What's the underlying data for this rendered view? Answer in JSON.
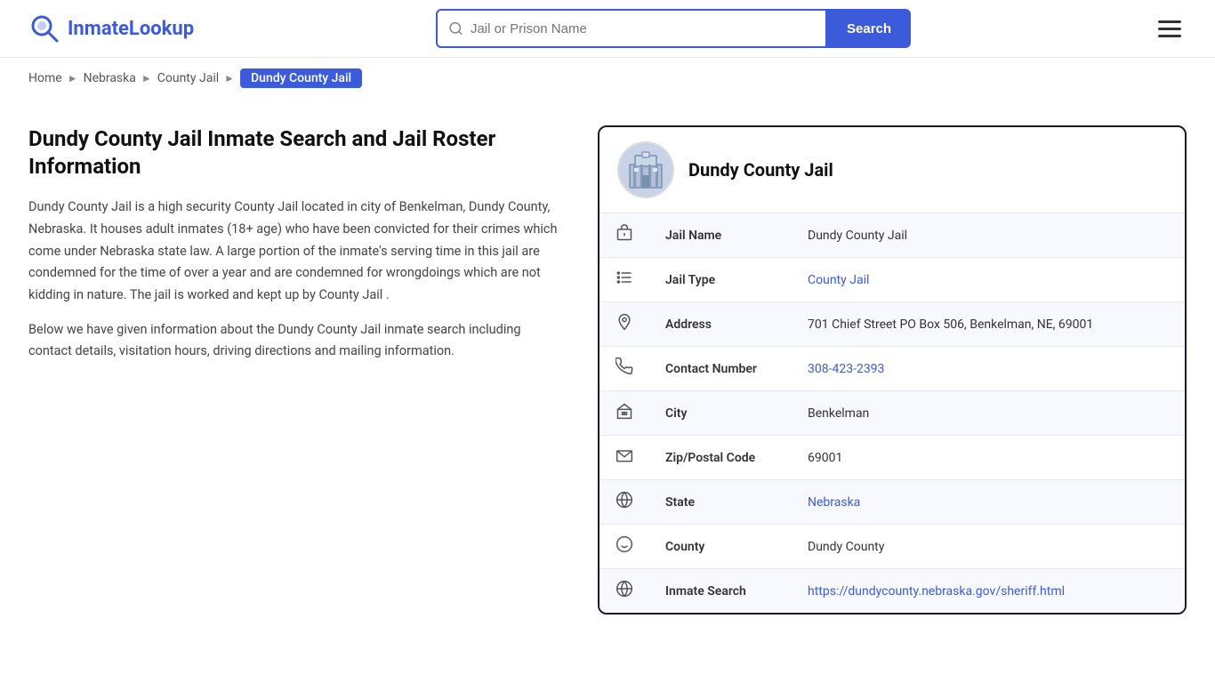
{
  "header": {
    "logo_brand": "InmateLookup",
    "logo_brand_first": "Inmate",
    "logo_brand_second": "Lookup",
    "search_placeholder": "Jail or Prison Name",
    "search_button_label": "Search"
  },
  "breadcrumb": {
    "items": [
      {
        "label": "Home",
        "href": "#"
      },
      {
        "label": "Nebraska",
        "href": "#"
      },
      {
        "label": "County Jail",
        "href": "#"
      },
      {
        "label": "Dundy County Jail",
        "current": true
      }
    ]
  },
  "left": {
    "page_title": "Dundy County Jail Inmate Search and Jail Roster Information",
    "description1": "Dundy County Jail is a high security County Jail located in city of Benkelman, Dundy County, Nebraska. It houses adult inmates (18+ age) who have been convicted for their crimes which come under Nebraska state law. A large portion of the inmate's serving time in this jail are condemned for the time of over a year and are condemned for wrongdoings which are not kidding in nature. The jail is worked and kept up by County Jail .",
    "description2": "Below we have given information about the Dundy County Jail inmate search including contact details, visitation hours, driving directions and mailing information."
  },
  "card": {
    "title": "Dundy County Jail",
    "rows": [
      {
        "icon": "jail",
        "label": "Jail Name",
        "value": "Dundy County Jail",
        "link": null
      },
      {
        "icon": "list",
        "label": "Jail Type",
        "value": "County Jail",
        "link": "#"
      },
      {
        "icon": "location",
        "label": "Address",
        "value": "701 Chief Street PO Box 506, Benkelman, NE, 69001",
        "link": null
      },
      {
        "icon": "phone",
        "label": "Contact Number",
        "value": "308-423-2393",
        "link": "tel:308-423-2393"
      },
      {
        "icon": "city",
        "label": "City",
        "value": "Benkelman",
        "link": null
      },
      {
        "icon": "zip",
        "label": "Zip/Postal Code",
        "value": "69001",
        "link": null
      },
      {
        "icon": "globe",
        "label": "State",
        "value": "Nebraska",
        "link": "#"
      },
      {
        "icon": "county",
        "label": "County",
        "value": "Dundy County",
        "link": null
      },
      {
        "icon": "search-globe",
        "label": "Inmate Search",
        "value": "https://dundycounty.nebraska.gov/sheriff.html",
        "link": "https://dundycounty.nebraska.gov/sheriff.html"
      }
    ]
  }
}
